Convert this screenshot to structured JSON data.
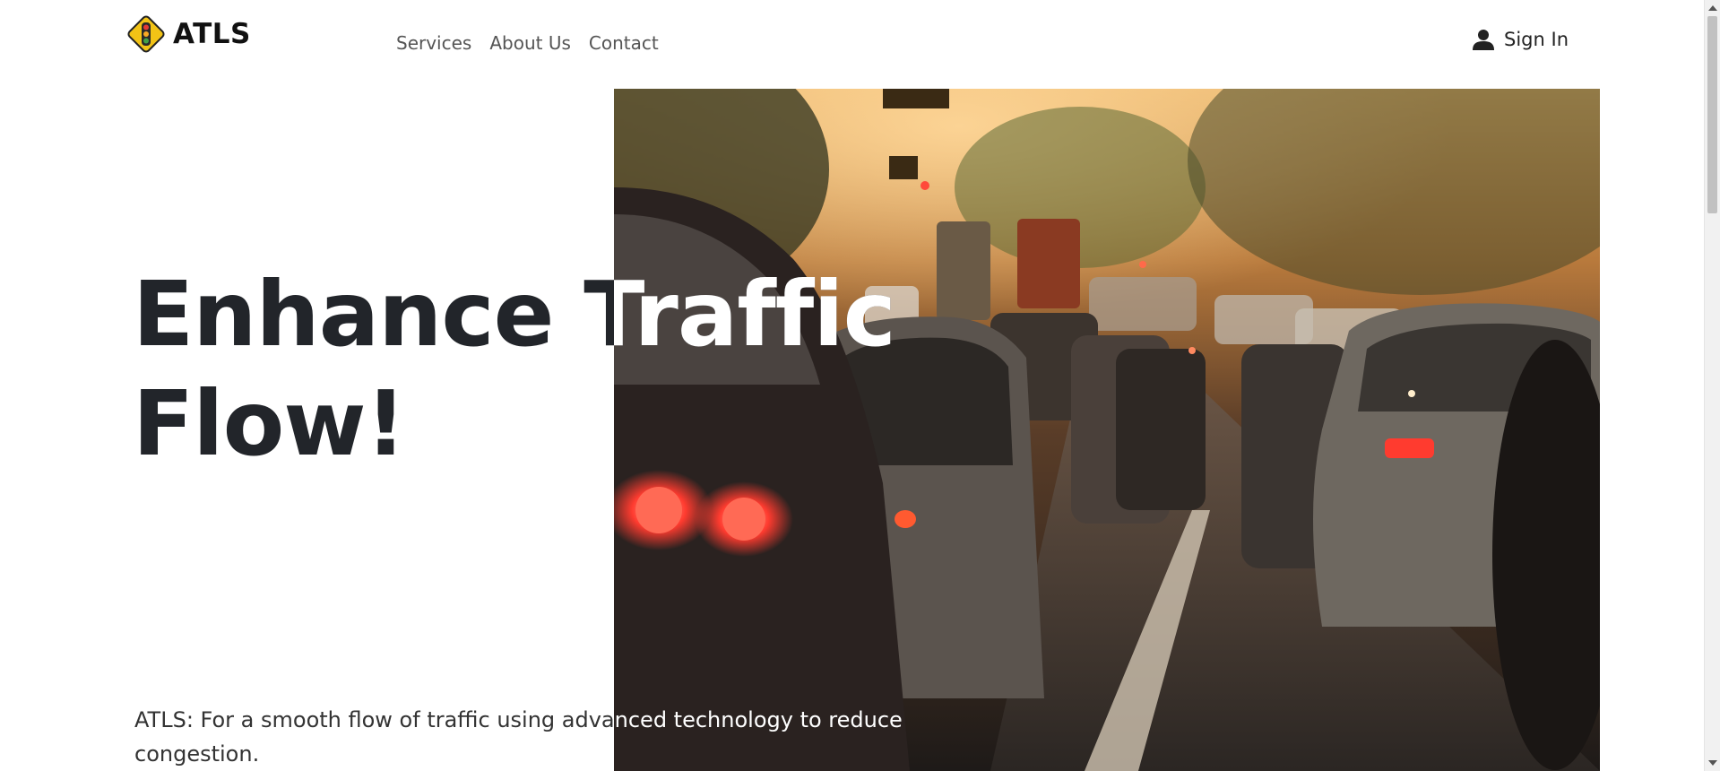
{
  "brand": {
    "name": "ATLS",
    "logo_icon": "traffic-light-icon",
    "logo_color": "#f2c316"
  },
  "nav": {
    "items": [
      {
        "label": "Services"
      },
      {
        "label": "About Us"
      },
      {
        "label": "Contact"
      }
    ]
  },
  "account": {
    "signin_label": "Sign In",
    "icon": "user-icon"
  },
  "hero": {
    "title_line1": "Enhance Traffic",
    "title_line2": "Flow!",
    "subtitle": "ATLS: For a smooth flow of traffic using advanced technology to reduce congestion.",
    "image_alt": "traffic-jam-photo",
    "text_color": "#22252a"
  }
}
